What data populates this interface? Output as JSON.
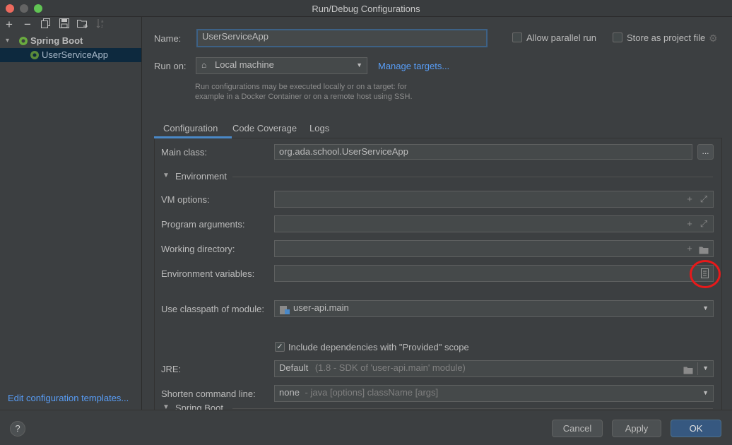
{
  "window": {
    "title": "Run/Debug Configurations"
  },
  "toolbar": {
    "add": "+",
    "remove": "−",
    "copy_icon": "copy-icon",
    "save_icon": "save-icon",
    "folder_icon": "new-folder-icon",
    "sort_icon": "sort-icon"
  },
  "tree": {
    "group_label": "Spring Boot",
    "item_label": "UserServiceApp"
  },
  "left": {
    "edit_templates": "Edit configuration templates..."
  },
  "form": {
    "name_label": "Name:",
    "name_value": "UserServiceApp",
    "allow_parallel": "Allow parallel run",
    "store_as_project": "Store as project file",
    "run_on_label": "Run on:",
    "run_on_value": "Local machine",
    "manage_targets": "Manage targets...",
    "hint_line1": "Run configurations may be executed locally or on a target: for",
    "hint_line2": "example in a Docker Container or on a remote host using SSH."
  },
  "tabs": [
    "Configuration",
    "Code Coverage",
    "Logs"
  ],
  "config": {
    "main_class_label": "Main class:",
    "main_class_value": "org.ada.school.UserServiceApp",
    "dots": "...",
    "environment_section": "Environment",
    "vm_options_label": "VM options:",
    "program_args_label": "Program arguments:",
    "working_dir_label": "Working directory:",
    "env_vars_label": "Environment variables:",
    "classpath_label": "Use classpath of module:",
    "classpath_value": "user-api.main",
    "include_deps": "Include dependencies with \"Provided\" scope",
    "jre_label": "JRE:",
    "jre_value": "Default",
    "jre_detail": "(1.8 - SDK of 'user-api.main' module)",
    "shorten_label": "Shorten command line:",
    "shorten_value": "none",
    "shorten_detail": "- java [options] className [args]",
    "spring_boot_section": "Spring Boot"
  },
  "buttons": {
    "help": "?",
    "cancel": "Cancel",
    "apply": "Apply",
    "ok": "OK"
  },
  "colors": {
    "accent": "#589df6",
    "highlight_circle": "#e8191a",
    "primary_button": "#365880"
  }
}
